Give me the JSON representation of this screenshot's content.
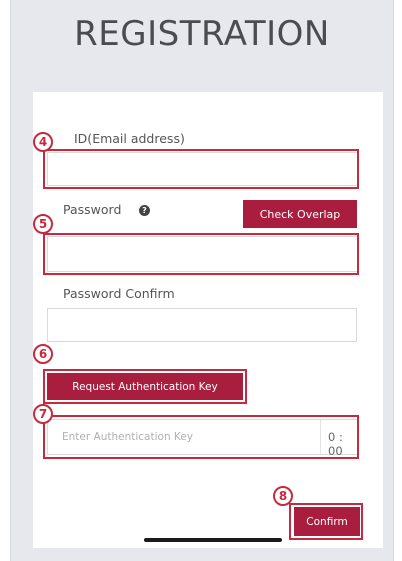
{
  "page": {
    "title": "REGISTRATION"
  },
  "form": {
    "id_label": "ID(Email address)",
    "password_label": "Password",
    "password_help_glyph": "?",
    "check_overlap_label": "Check Overlap",
    "password_confirm_label": "Password Confirm",
    "request_key_label": "Request Authentication Key",
    "auth_key_placeholder": "Enter Authentication Key",
    "timer": "0 : 00",
    "confirm_label": "Confirm"
  },
  "callouts": {
    "id": "4",
    "password": "5",
    "request": "6",
    "auth_key": "7",
    "confirm": "8"
  },
  "colors": {
    "accent": "#a91e3f",
    "callout": "#c62a3e",
    "background": "#e7e8ee"
  }
}
